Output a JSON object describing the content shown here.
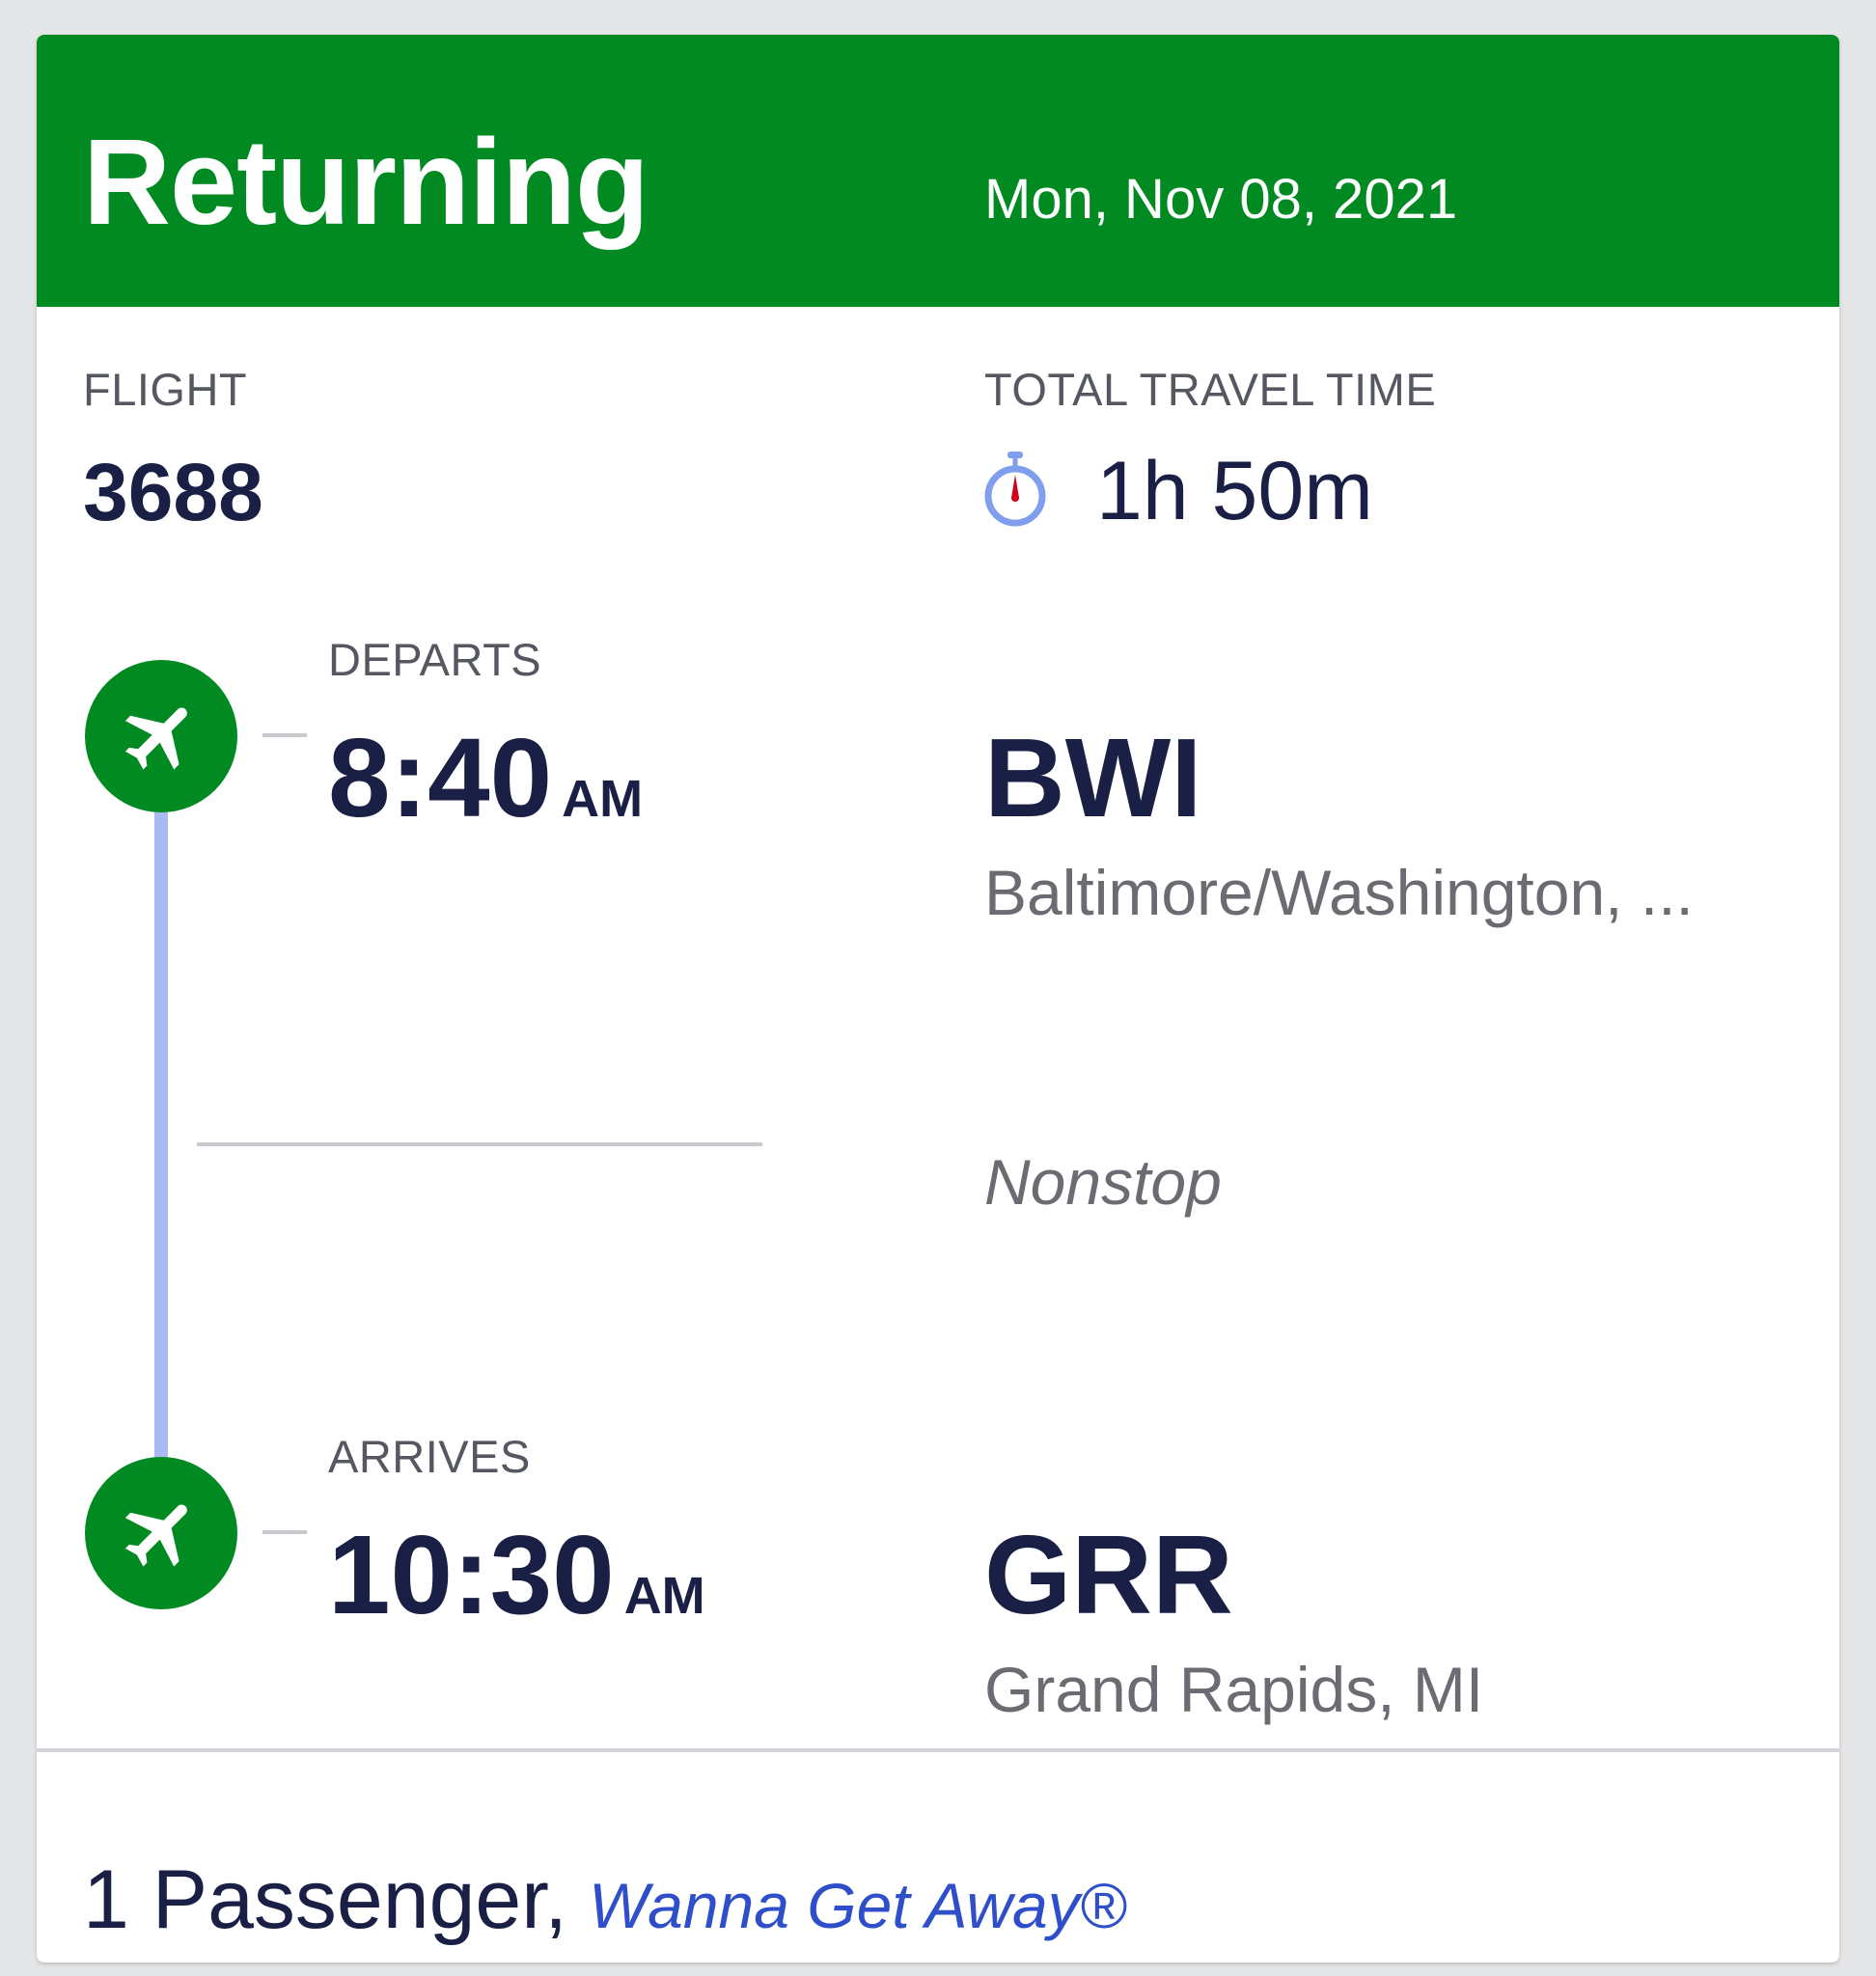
{
  "header": {
    "title": "Returning",
    "date": "Mon, Nov 08, 2021"
  },
  "flight": {
    "label": "FLIGHT",
    "number": "3688"
  },
  "travel_time": {
    "label": "TOTAL TRAVEL TIME",
    "value": "1h 50m",
    "icon": "stopwatch-icon"
  },
  "departure": {
    "label": "DEPARTS",
    "time": "8:40",
    "ampm": "AM",
    "airport_code": "BWI",
    "city": "Baltimore/Washington, ...",
    "icon": "airplane-icon"
  },
  "stops": {
    "label": "Nonstop"
  },
  "arrival": {
    "label": "ARRIVES",
    "time": "10:30",
    "ampm": "AM",
    "airport_code": "GRR",
    "city": "Grand Rapids, MI",
    "icon": "airplane-icon"
  },
  "footer": {
    "passengers": "1 Passenger,",
    "fare_class": "Wanna Get Away®"
  },
  "colors": {
    "header_green": "#008a21",
    "navy_text": "#1a2045",
    "fare_blue": "#2e4fc9",
    "track_blue": "#a7baf2",
    "stopwatch_needle": "#d0021b"
  }
}
